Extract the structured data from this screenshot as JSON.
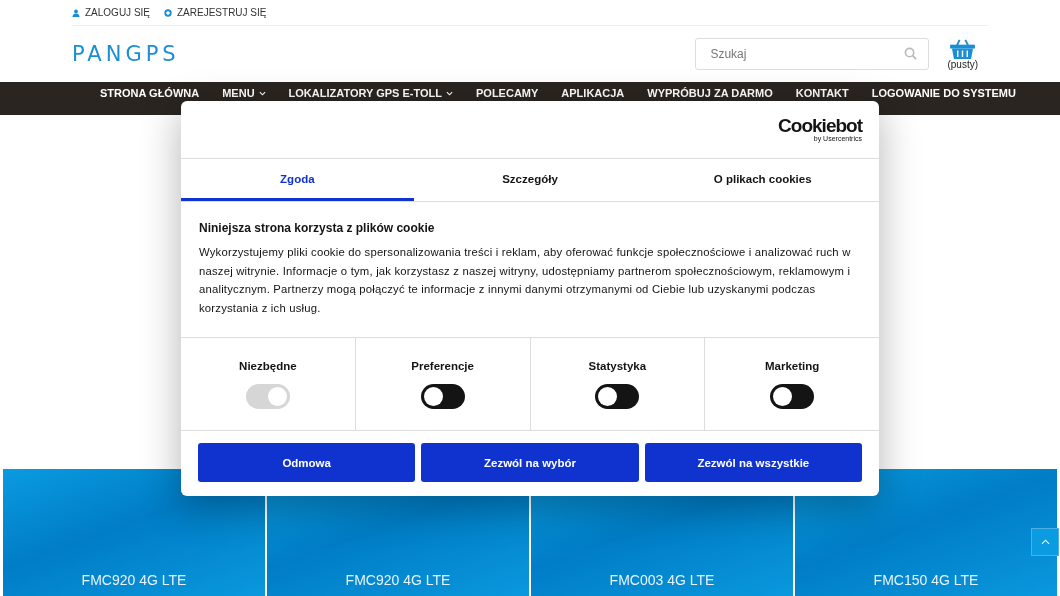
{
  "top_links": [
    {
      "kind": "user",
      "label": "ZALOGUJ SIĘ"
    },
    {
      "kind": "plus",
      "label": "ZAREJESTRUJ SIĘ"
    }
  ],
  "logo": "PANGPS",
  "search": {
    "placeholder": "Szukaj"
  },
  "cart": {
    "label": "(pusty)"
  },
  "nav": [
    {
      "label": "STRONA GŁÓWNA",
      "dropdown": false
    },
    {
      "label": "MENU",
      "dropdown": true
    },
    {
      "label": "LOKALIZATORY GPS E-TOLL",
      "dropdown": true
    },
    {
      "label": "POLECAMY",
      "dropdown": false
    },
    {
      "label": "APLIKACJA",
      "dropdown": false
    },
    {
      "label": "WYPRÓBUJ ZA DARMO",
      "dropdown": false
    },
    {
      "label": "KONTAKT",
      "dropdown": false
    },
    {
      "label": "LOGOWANIE DO SYSTEMU",
      "dropdown": false
    }
  ],
  "products": [
    {
      "name": "FMC920 4G LTE"
    },
    {
      "name": "FMC920 4G LTE"
    },
    {
      "name": "FMC003 4G LTE"
    },
    {
      "name": "FMC150 4G LTE"
    }
  ],
  "cookie_dialog": {
    "brand": "Cookiebot",
    "brand_sub": "by Usercentrics",
    "tabs": [
      {
        "label": "Zgoda",
        "selected": true
      },
      {
        "label": "Szczegóły",
        "selected": false
      },
      {
        "label": "O plikach cookies",
        "selected": false
      }
    ],
    "title": "Niniejsza strona korzysta z plików cookie",
    "text": "Wykorzystujemy pliki cookie do spersonalizowania treści i reklam, aby oferować funkcje społecznościowe i analizować ruch w naszej witrynie. Informacje o tym, jak korzystasz z naszej witryny, udostępniamy partnerom społecznościowym, reklamowym i analitycznym. Partnerzy mogą połączyć te informacje z innymi danymi otrzymanymi od Ciebie lub uzyskanymi podczas korzystania z ich usług.",
    "categories": [
      {
        "label": "Niezbędne",
        "checked": true,
        "disabled": true
      },
      {
        "label": "Preferencje",
        "checked": false,
        "disabled": false
      },
      {
        "label": "Statystyka",
        "checked": false,
        "disabled": false
      },
      {
        "label": "Marketing",
        "checked": false,
        "disabled": false
      }
    ],
    "buttons": [
      "Odmowa",
      "Zezwól na wybór",
      "Zezwól na wszystkie"
    ]
  }
}
